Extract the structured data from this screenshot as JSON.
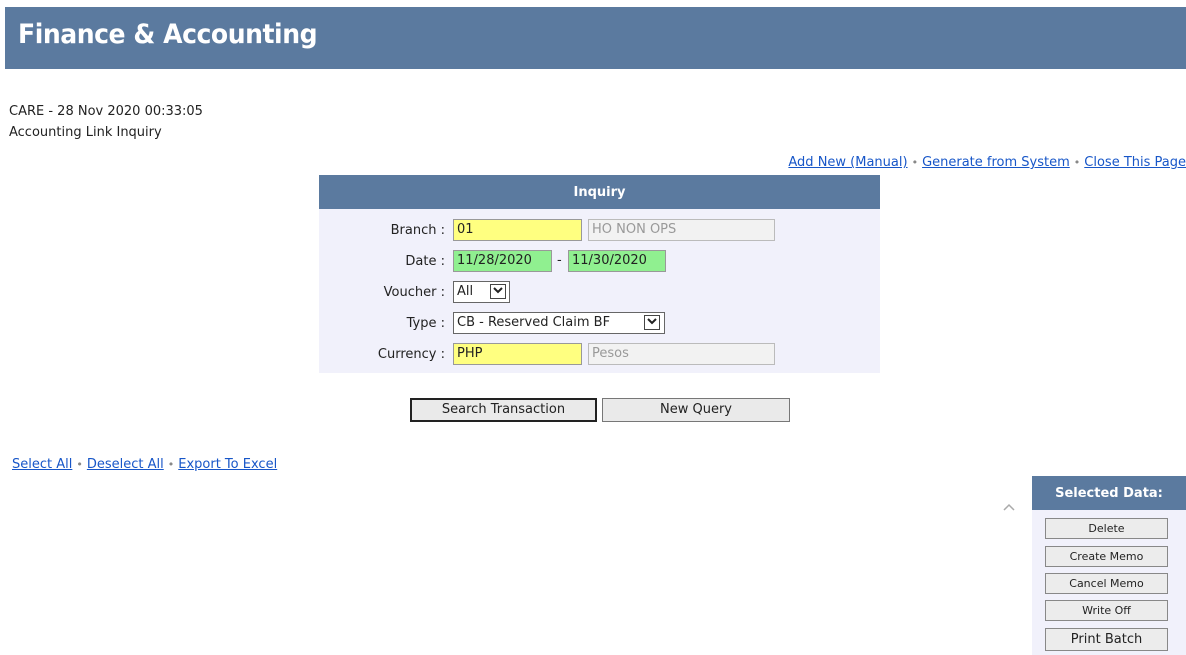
{
  "header": {
    "title": "Finance & Accounting"
  },
  "meta": {
    "line1": "CARE - 28 Nov 2020 00:33:05",
    "line2": "Accounting Link Inquiry"
  },
  "top_links": {
    "add_new": "Add New (Manual)",
    "generate": "Generate from System",
    "close": "Close This Page"
  },
  "inquiry": {
    "title": "Inquiry",
    "branch": {
      "label": "Branch :",
      "code": "01",
      "name": "HO NON OPS"
    },
    "date": {
      "label": "Date :",
      "from": "11/28/2020",
      "dash": "-",
      "to": "11/30/2020"
    },
    "voucher": {
      "label": "Voucher :",
      "value": "All"
    },
    "type": {
      "label": "Type :",
      "value": "CB - Reserved Claim BF"
    },
    "currency": {
      "label": "Currency :",
      "code": "PHP",
      "name": "Pesos"
    }
  },
  "buttons": {
    "search": "Search Transaction",
    "new_query": "New Query"
  },
  "list_links": {
    "select_all": "Select All",
    "deselect_all": "Deselect All",
    "export": "Export To Excel"
  },
  "selected_panel": {
    "title": "Selected Data:",
    "delete": "Delete",
    "create_memo": "Create Memo",
    "cancel_memo": "Cancel Memo",
    "write_off": "Write Off",
    "print_batch": "Print Batch"
  },
  "colors": {
    "header_bg": "#5b7a9f",
    "required_field": "#ffff80",
    "date_field": "#90f090",
    "link": "#1756c8"
  },
  "icons": {
    "dropdown": "chevron-down-icon",
    "collapse": "chevron-up-icon"
  }
}
